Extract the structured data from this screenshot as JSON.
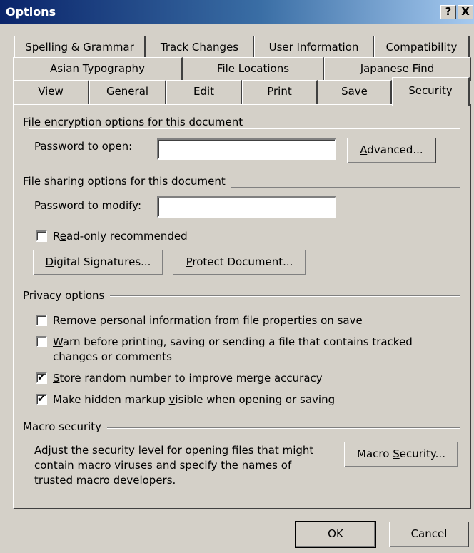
{
  "window": {
    "title": "Options",
    "help_glyph": "?",
    "close_glyph": "X"
  },
  "tabs": {
    "row1": [
      "Spelling & Grammar",
      "Track Changes",
      "User Information",
      "Compatibility"
    ],
    "row2": [
      "Asian Typography",
      "File Locations",
      "Japanese Find"
    ],
    "row3": [
      "View",
      "General",
      "Edit",
      "Print",
      "Save",
      "Security"
    ],
    "active": "Security"
  },
  "encryption": {
    "heading": "File encryption options for this document",
    "password_label_pre": "Password to ",
    "password_label_key": "o",
    "password_label_post": "pen:",
    "password_value": "",
    "advanced_pre": "",
    "advanced_key": "A",
    "advanced_post": "dvanced..."
  },
  "sharing": {
    "heading": "File sharing options for this document",
    "modify_label_pre": "Password to ",
    "modify_label_key": "m",
    "modify_label_post": "odify:",
    "modify_value": "",
    "readonly_pre": "R",
    "readonly_key": "e",
    "readonly_post": "ad-only recommended",
    "readonly_checked": false,
    "digsig_key": "D",
    "digsig_post": "igital Signatures...",
    "protect_key": "P",
    "protect_post": "rotect Document..."
  },
  "privacy": {
    "heading": "Privacy options",
    "options": [
      {
        "key": "R",
        "rest": "emove personal information from file properties on save",
        "line2": "",
        "checked": false
      },
      {
        "key": "W",
        "rest": "arn before printing, saving or sending a file that contains tracked",
        "line2": "changes or comments",
        "checked": false
      },
      {
        "key": "S",
        "rest": "tore random number to improve merge accuracy",
        "line2": "",
        "checked": true
      },
      {
        "pre": "Make hidden markup ",
        "key": "v",
        "rest": "isible when opening or saving",
        "line2": "",
        "checked": true
      }
    ],
    "check_glyph": "✔"
  },
  "macro": {
    "heading": "Macro security",
    "description_lines": [
      "Adjust the security level for opening files that might",
      "contain macro viruses and specify the names of",
      "trusted macro developers."
    ],
    "button_pre": "Macro ",
    "button_key": "S",
    "button_post": "ecurity..."
  },
  "footer": {
    "ok_label": "OK",
    "cancel_label": "Cancel"
  }
}
